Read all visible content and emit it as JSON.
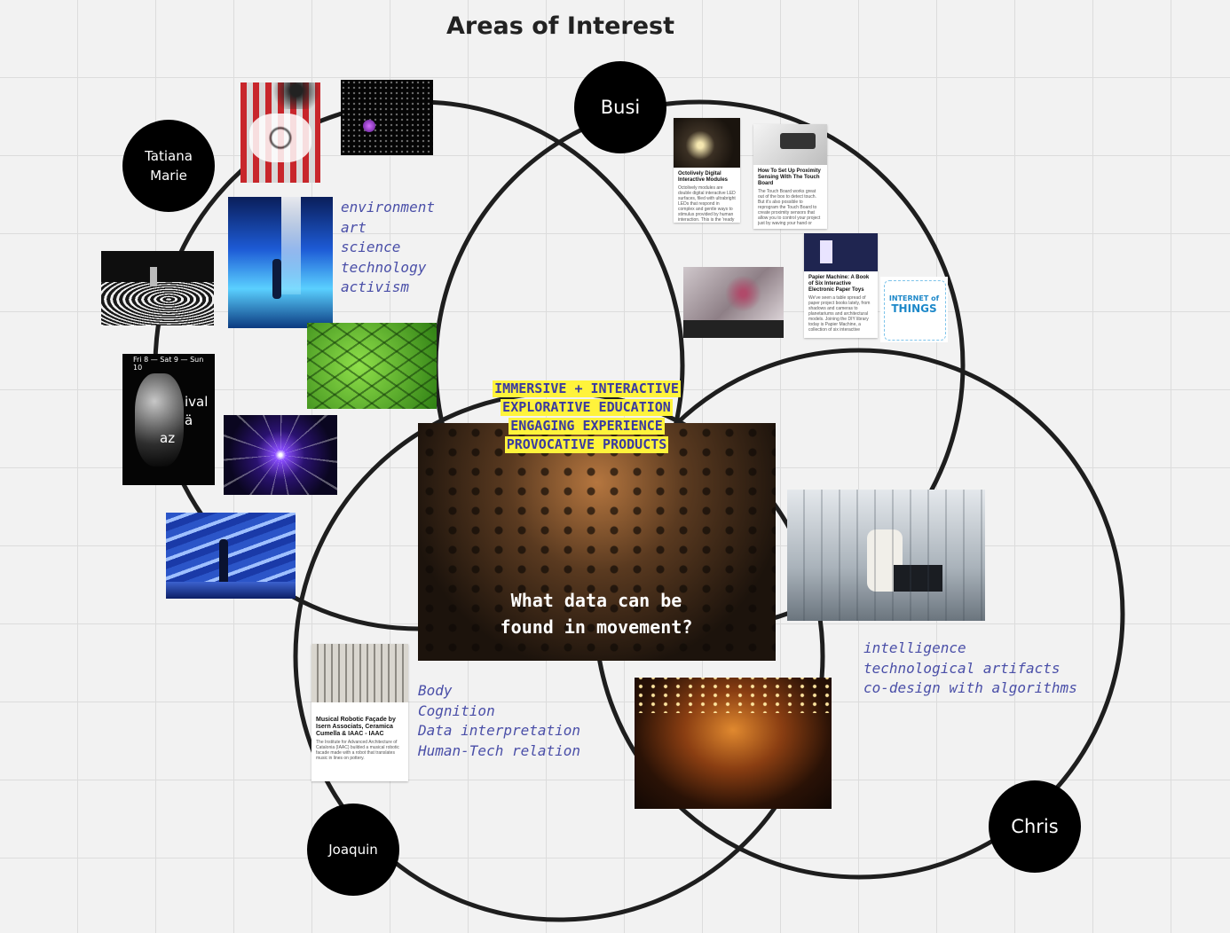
{
  "board": {
    "title": "Areas of Interest"
  },
  "people": {
    "tatiana": "Tatiana\nMarie",
    "busi": "Busi",
    "joaquin": "Joaquin",
    "chris": "Chris"
  },
  "notes": {
    "tatiana": [
      "environment",
      "art",
      "science",
      "technology",
      "activism"
    ],
    "joaquin": [
      "Body",
      "Cognition",
      "Data interpretation",
      "Human-Tech relation"
    ],
    "chris": [
      "intelligence",
      "technological artifacts",
      "co-design with algorithms"
    ]
  },
  "center": {
    "highlights": [
      "IMMERSIVE + INTERACTIVE",
      "EXPLORATIVE EDUCATION",
      "ENGAGING EXPERIENCE",
      "PROVOCATIVE PRODUCTS"
    ],
    "question_line1": "What data can be",
    "question_line2": "found in movement?"
  },
  "cards": {
    "octolively": {
      "title": "Octolively Digital Interactive Modules",
      "body": "Octolively modules are double digital interactive LED surfaces, filed with ultrabright LEDs that respond in complex and gentle ways to stimulus provided by human interaction. This is the 'ready to use' version of Octolively. The modules come fully as..."
    },
    "touchboard": {
      "title": "How To Set Up Proximity Sensing With The Touch Board",
      "body": "The Touch Board works great out of the box to detect touch. But it's also possible to reprogram the Touch Board to create proximity sensors that allow you to control your project just by waving your hand or approaching the sensors."
    },
    "papier": {
      "title": "Papier Machine: A Book of Six Interactive Electronic Paper Toys",
      "body": "We've seen a table spread of paper project books lately, from shadows and cameras to planetariums and architectural models. Joining the DIY library today is Papier Machine, a collection of six interactive electronic paper toys all gathered together within."
    },
    "musical": {
      "title": "Musical Robotic Façade by Isern Associats, Ceramica Cumella & IAAC - IAAC",
      "body": "The Institute for Advanced Architecture of Catalonia (IAAC) builded a musical robotic facade made with a robot that translates music in lines on pottery."
    }
  },
  "poster": {
    "dates": "Fri 8 — Sat 9 — Sun 10",
    "word1": "ival",
    "word2": "ä",
    "word3": "az"
  },
  "iot": {
    "line1": "INTERNET of",
    "line2": "THINGS"
  },
  "colors": {
    "circle_stroke": "#1e1e1e",
    "note_text": "#4a4fa8",
    "highlight": "#fff33b"
  }
}
